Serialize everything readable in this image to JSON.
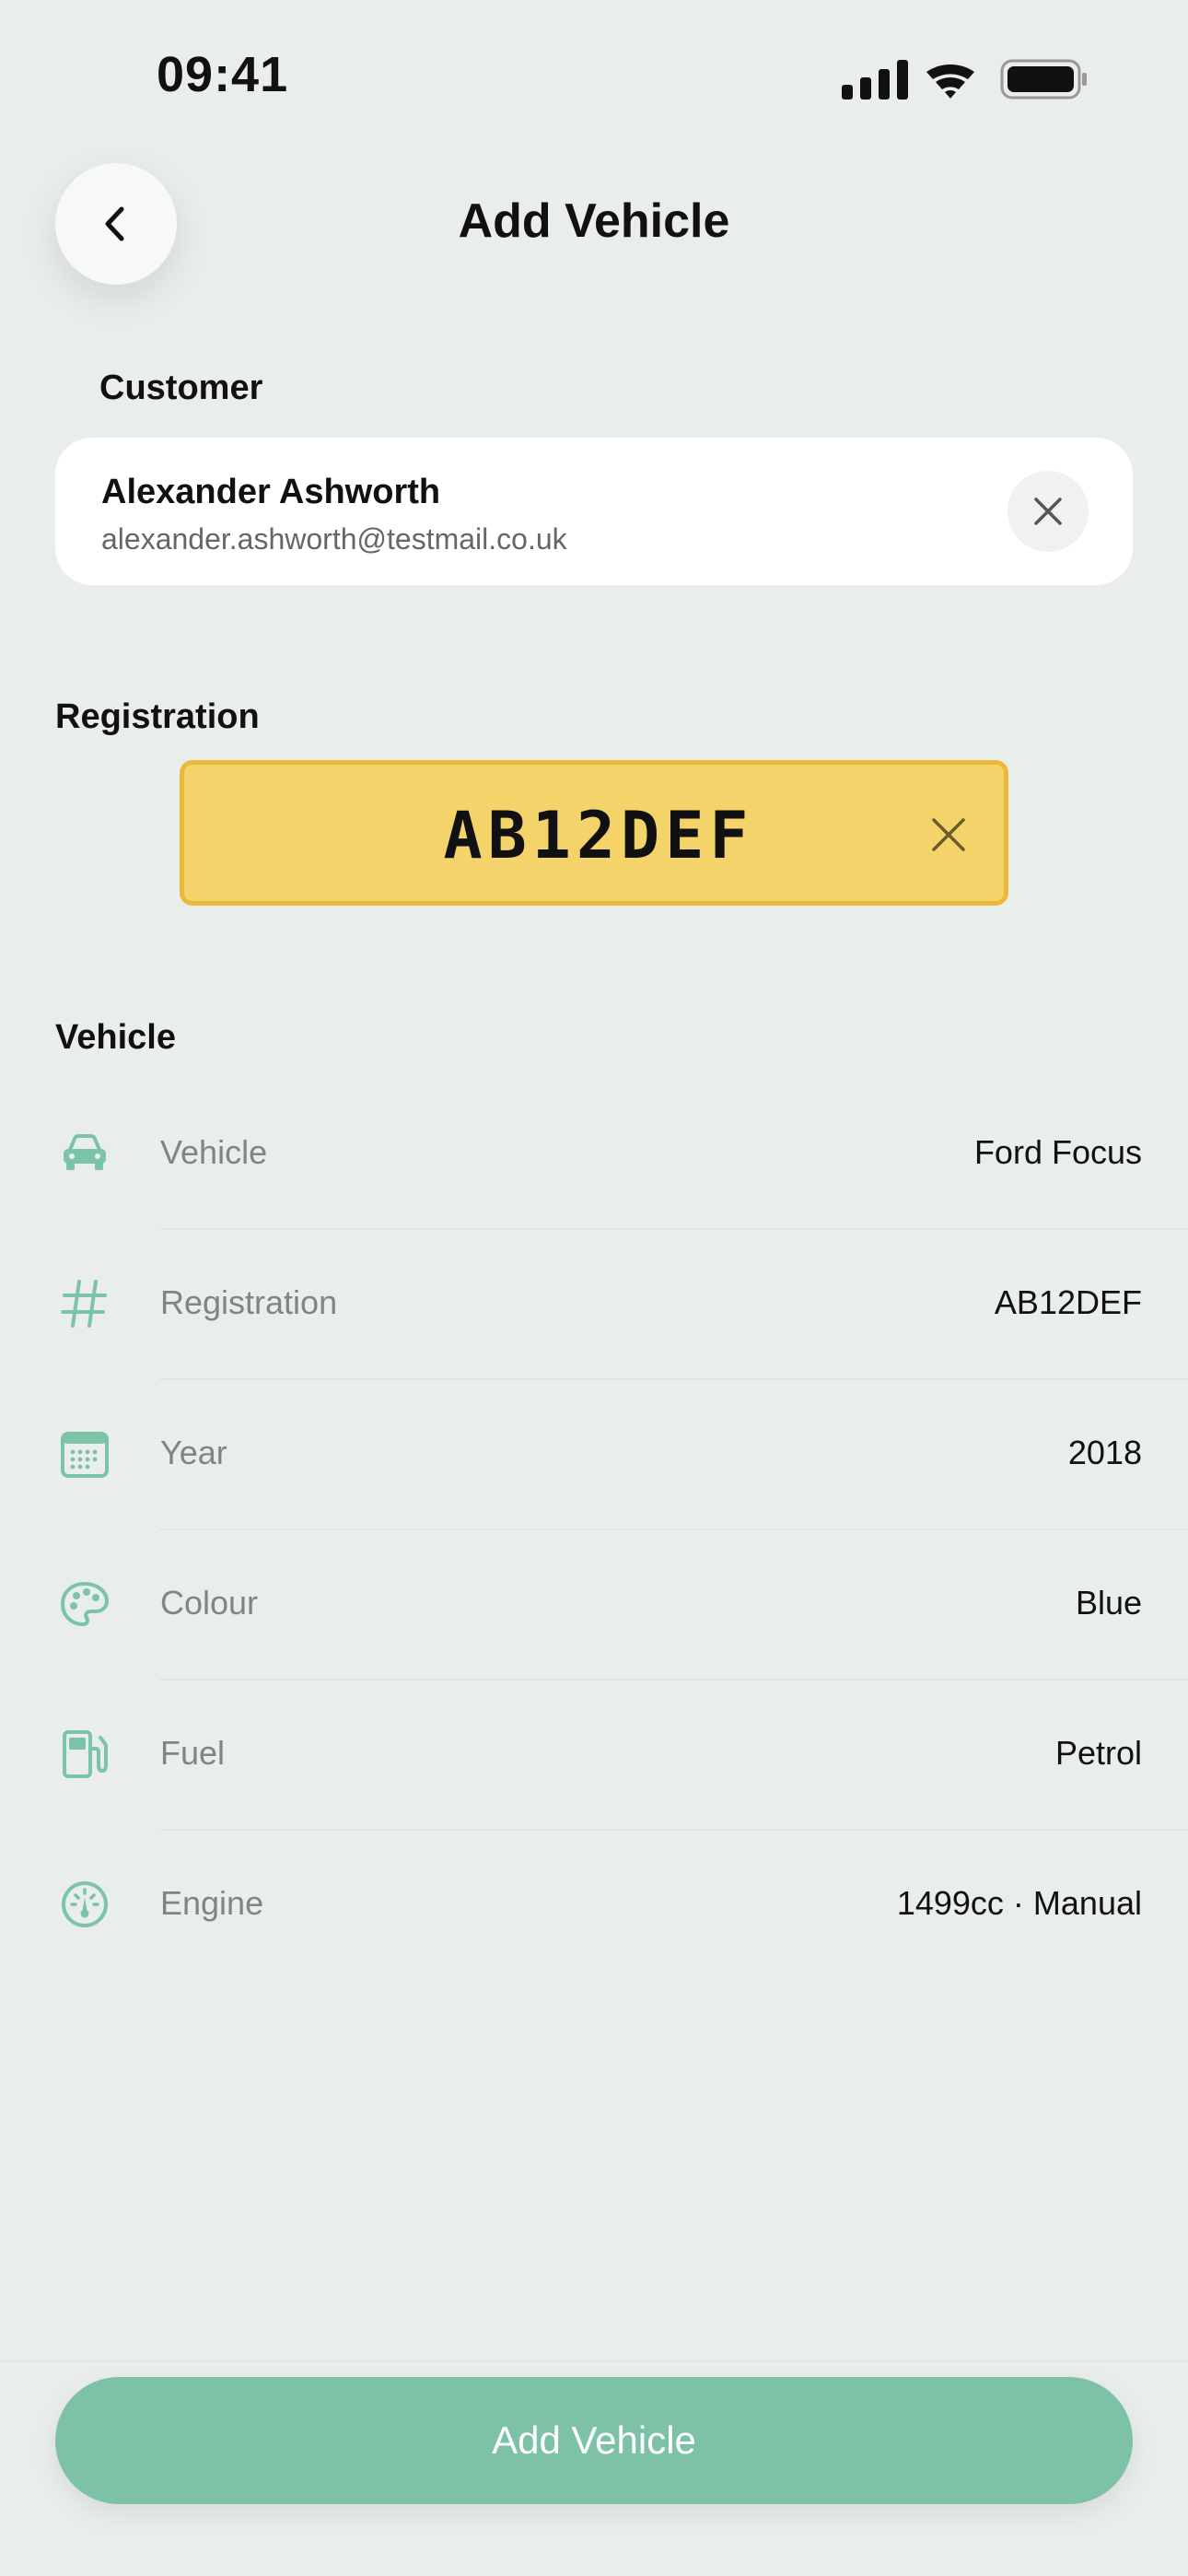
{
  "status_bar": {
    "time": "09:41"
  },
  "header": {
    "title": "Add Vehicle",
    "back_icon": "chevron-left-icon"
  },
  "customer": {
    "section_label": "Customer",
    "name": "Alexander Ashworth",
    "email": "alexander.ashworth@testmail.co.uk"
  },
  "registration": {
    "section_label": "Registration",
    "plate": "AB12DEF",
    "plate_color": "#F4D46A"
  },
  "vehicle": {
    "section_label": "Vehicle",
    "rows": [
      {
        "icon": "car-icon",
        "label": "Vehicle",
        "value": "Ford Focus"
      },
      {
        "icon": "hash-icon",
        "label": "Registration",
        "value": "AB12DEF"
      },
      {
        "icon": "calendar-icon",
        "label": "Year",
        "value": "2018"
      },
      {
        "icon": "palette-icon",
        "label": "Colour",
        "value": "Blue"
      },
      {
        "icon": "fuel-pump-icon",
        "label": "Fuel",
        "value": "Petrol"
      },
      {
        "icon": "gauge-icon",
        "label": "Engine",
        "value": "1499cc · Manual"
      }
    ]
  },
  "footer": {
    "add_button_label": "Add Vehicle"
  },
  "colors": {
    "accent": "#7DC1A6",
    "icon": "#7CC4A8",
    "background": "#E9EDEB"
  }
}
